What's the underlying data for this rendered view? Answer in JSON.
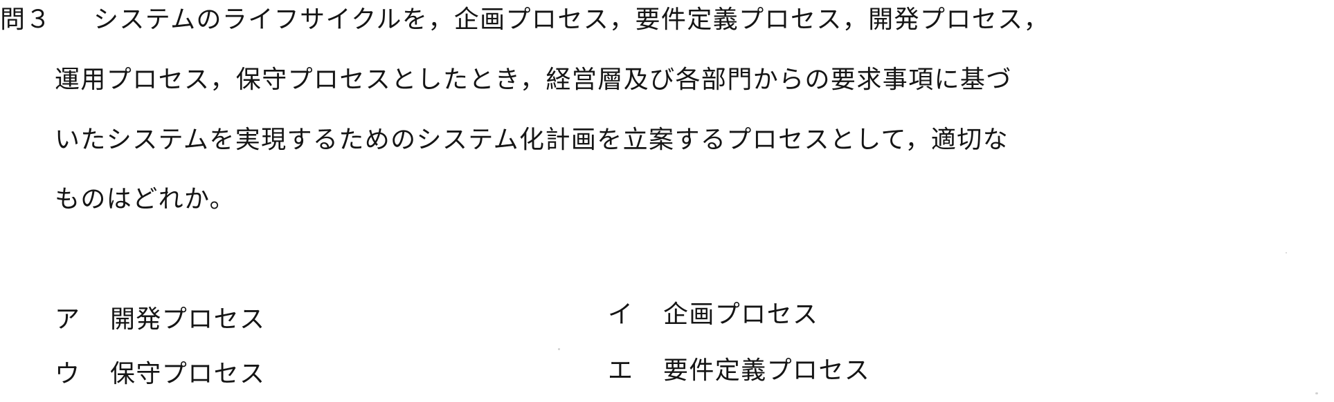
{
  "question": {
    "number": "問３",
    "lines": [
      "システムのライフサイクルを，企画プロセス，要件定義プロセス，開発プロセス，",
      "運用プロセス，保守プロセスとしたとき，経営層及び各部門からの要求事項に基づ",
      "いたシステムを実現するためのシステム化計画を立案するプロセスとして，適切な",
      "ものはどれか。"
    ]
  },
  "choices": [
    {
      "letter": "ア",
      "text": "開発プロセス"
    },
    {
      "letter": "イ",
      "text": "企画プロセス"
    },
    {
      "letter": "ウ",
      "text": "保守プロセス"
    },
    {
      "letter": "エ",
      "text": "要件定義プロセス"
    }
  ]
}
